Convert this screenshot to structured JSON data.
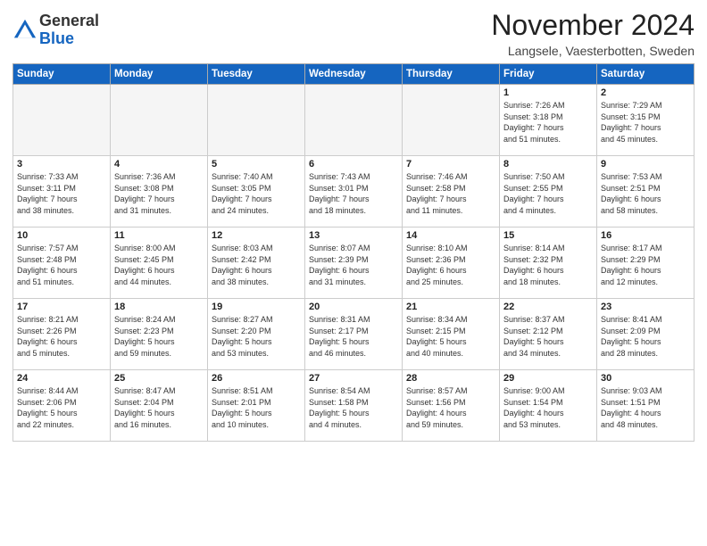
{
  "logo": {
    "general": "General",
    "blue": "Blue"
  },
  "header": {
    "month_title": "November 2024",
    "location": "Langsele, Vaesterbotten, Sweden"
  },
  "weekdays": [
    "Sunday",
    "Monday",
    "Tuesday",
    "Wednesday",
    "Thursday",
    "Friday",
    "Saturday"
  ],
  "weeks": [
    [
      {
        "day": "",
        "info": ""
      },
      {
        "day": "",
        "info": ""
      },
      {
        "day": "",
        "info": ""
      },
      {
        "day": "",
        "info": ""
      },
      {
        "day": "",
        "info": ""
      },
      {
        "day": "1",
        "info": "Sunrise: 7:26 AM\nSunset: 3:18 PM\nDaylight: 7 hours\nand 51 minutes."
      },
      {
        "day": "2",
        "info": "Sunrise: 7:29 AM\nSunset: 3:15 PM\nDaylight: 7 hours\nand 45 minutes."
      }
    ],
    [
      {
        "day": "3",
        "info": "Sunrise: 7:33 AM\nSunset: 3:11 PM\nDaylight: 7 hours\nand 38 minutes."
      },
      {
        "day": "4",
        "info": "Sunrise: 7:36 AM\nSunset: 3:08 PM\nDaylight: 7 hours\nand 31 minutes."
      },
      {
        "day": "5",
        "info": "Sunrise: 7:40 AM\nSunset: 3:05 PM\nDaylight: 7 hours\nand 24 minutes."
      },
      {
        "day": "6",
        "info": "Sunrise: 7:43 AM\nSunset: 3:01 PM\nDaylight: 7 hours\nand 18 minutes."
      },
      {
        "day": "7",
        "info": "Sunrise: 7:46 AM\nSunset: 2:58 PM\nDaylight: 7 hours\nand 11 minutes."
      },
      {
        "day": "8",
        "info": "Sunrise: 7:50 AM\nSunset: 2:55 PM\nDaylight: 7 hours\nand 4 minutes."
      },
      {
        "day": "9",
        "info": "Sunrise: 7:53 AM\nSunset: 2:51 PM\nDaylight: 6 hours\nand 58 minutes."
      }
    ],
    [
      {
        "day": "10",
        "info": "Sunrise: 7:57 AM\nSunset: 2:48 PM\nDaylight: 6 hours\nand 51 minutes."
      },
      {
        "day": "11",
        "info": "Sunrise: 8:00 AM\nSunset: 2:45 PM\nDaylight: 6 hours\nand 44 minutes."
      },
      {
        "day": "12",
        "info": "Sunrise: 8:03 AM\nSunset: 2:42 PM\nDaylight: 6 hours\nand 38 minutes."
      },
      {
        "day": "13",
        "info": "Sunrise: 8:07 AM\nSunset: 2:39 PM\nDaylight: 6 hours\nand 31 minutes."
      },
      {
        "day": "14",
        "info": "Sunrise: 8:10 AM\nSunset: 2:36 PM\nDaylight: 6 hours\nand 25 minutes."
      },
      {
        "day": "15",
        "info": "Sunrise: 8:14 AM\nSunset: 2:32 PM\nDaylight: 6 hours\nand 18 minutes."
      },
      {
        "day": "16",
        "info": "Sunrise: 8:17 AM\nSunset: 2:29 PM\nDaylight: 6 hours\nand 12 minutes."
      }
    ],
    [
      {
        "day": "17",
        "info": "Sunrise: 8:21 AM\nSunset: 2:26 PM\nDaylight: 6 hours\nand 5 minutes."
      },
      {
        "day": "18",
        "info": "Sunrise: 8:24 AM\nSunset: 2:23 PM\nDaylight: 5 hours\nand 59 minutes."
      },
      {
        "day": "19",
        "info": "Sunrise: 8:27 AM\nSunset: 2:20 PM\nDaylight: 5 hours\nand 53 minutes."
      },
      {
        "day": "20",
        "info": "Sunrise: 8:31 AM\nSunset: 2:17 PM\nDaylight: 5 hours\nand 46 minutes."
      },
      {
        "day": "21",
        "info": "Sunrise: 8:34 AM\nSunset: 2:15 PM\nDaylight: 5 hours\nand 40 minutes."
      },
      {
        "day": "22",
        "info": "Sunrise: 8:37 AM\nSunset: 2:12 PM\nDaylight: 5 hours\nand 34 minutes."
      },
      {
        "day": "23",
        "info": "Sunrise: 8:41 AM\nSunset: 2:09 PM\nDaylight: 5 hours\nand 28 minutes."
      }
    ],
    [
      {
        "day": "24",
        "info": "Sunrise: 8:44 AM\nSunset: 2:06 PM\nDaylight: 5 hours\nand 22 minutes."
      },
      {
        "day": "25",
        "info": "Sunrise: 8:47 AM\nSunset: 2:04 PM\nDaylight: 5 hours\nand 16 minutes."
      },
      {
        "day": "26",
        "info": "Sunrise: 8:51 AM\nSunset: 2:01 PM\nDaylight: 5 hours\nand 10 minutes."
      },
      {
        "day": "27",
        "info": "Sunrise: 8:54 AM\nSunset: 1:58 PM\nDaylight: 5 hours\nand 4 minutes."
      },
      {
        "day": "28",
        "info": "Sunrise: 8:57 AM\nSunset: 1:56 PM\nDaylight: 4 hours\nand 59 minutes."
      },
      {
        "day": "29",
        "info": "Sunrise: 9:00 AM\nSunset: 1:54 PM\nDaylight: 4 hours\nand 53 minutes."
      },
      {
        "day": "30",
        "info": "Sunrise: 9:03 AM\nSunset: 1:51 PM\nDaylight: 4 hours\nand 48 minutes."
      }
    ]
  ]
}
